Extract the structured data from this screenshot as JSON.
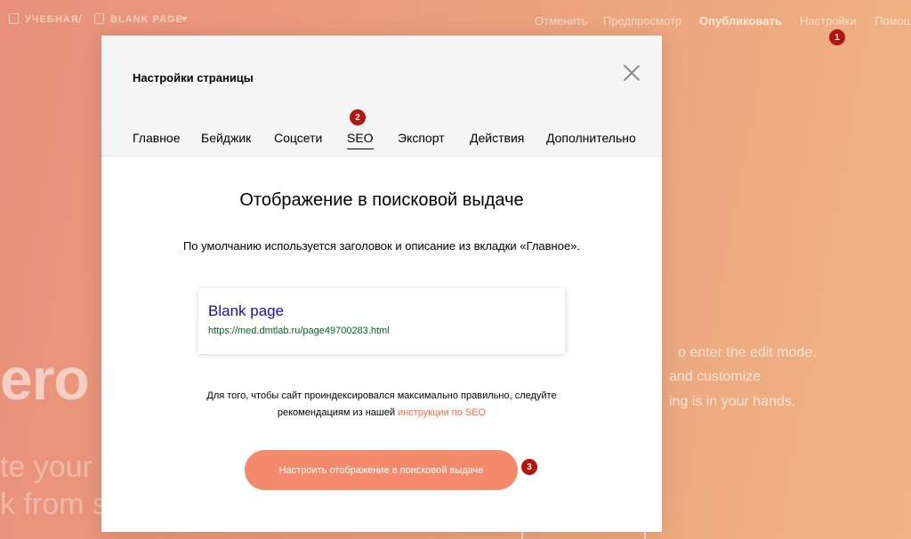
{
  "topbar": {
    "project": "УЧЕБНАЯ",
    "separator": "/",
    "page": "BLANK PAGE",
    "nav": {
      "undo": "Отменить",
      "preview": "Предпросмотр",
      "publish": "Опубликовать",
      "settings": "Настройки",
      "help": "Помощь"
    }
  },
  "background": {
    "big_word": "ero",
    "line1": "te your",
    "line2": "k from s",
    "text1": "o enter the edit mode.",
    "text2": "and customize",
    "text3": "ing is in your hands."
  },
  "badges": {
    "one": "1",
    "two": "2",
    "three": "3",
    "color": "#b3140d"
  },
  "modal": {
    "title": "Настройки страницы",
    "tabs": [
      {
        "label": "Главное"
      },
      {
        "label": "Бейджик"
      },
      {
        "label": "Соцсети"
      },
      {
        "label": "SEO"
      },
      {
        "label": "Экспорт"
      },
      {
        "label": "Действия"
      },
      {
        "label": "Дополнительно"
      }
    ],
    "active_tab": "SEO",
    "heading": "Отображение в поисковой выдаче",
    "description": "По умолчанию используется заголовок и описание из вкладки «Главное».",
    "search_preview": {
      "title": "Blank page",
      "url": "https://med.dmtlab.ru/page49700283.html"
    },
    "note_line1": "Для того, чтобы сайт проиндексировался максимально правильно, следуйте",
    "note_line2_prefix": "рекомендациям из нашей ",
    "note_link": "инструкции по SEO",
    "button": "Настроить отображение в поисковой выдаче",
    "accent_color": "#f48a6c"
  }
}
